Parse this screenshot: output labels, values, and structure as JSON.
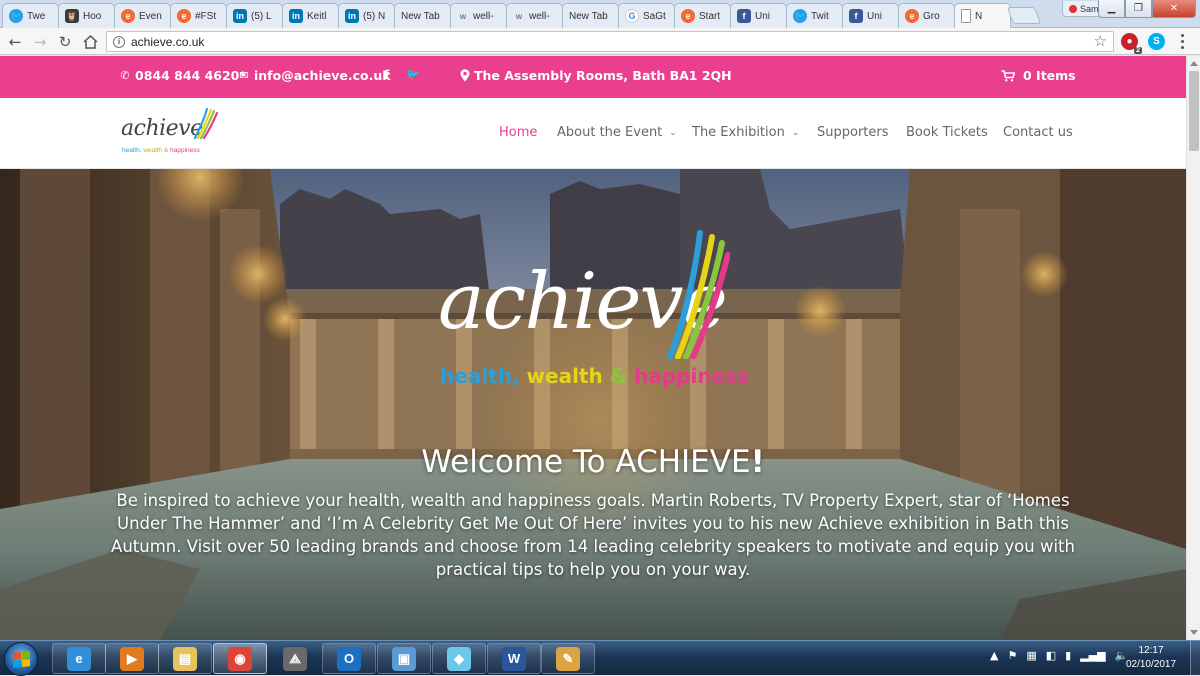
{
  "browser": {
    "tabs": [
      {
        "label": "Twe",
        "icon": "twitter-icon",
        "fav": "twitter",
        "glyph": "🐦"
      },
      {
        "label": "Hoo",
        "icon": "hootsuite-icon",
        "fav": "hoot",
        "glyph": "🦉"
      },
      {
        "label": "Even",
        "icon": "eventbrite-icon",
        "fav": "eventbrite",
        "glyph": "e"
      },
      {
        "label": "#FSt",
        "icon": "eventbrite-icon",
        "fav": "eventbrite",
        "glyph": "e"
      },
      {
        "label": "(5) L",
        "icon": "linkedin-icon",
        "fav": "linkedin",
        "glyph": "in"
      },
      {
        "label": "Keitl",
        "icon": "linkedin-icon",
        "fav": "linkedin",
        "glyph": "in"
      },
      {
        "label": "(5) N",
        "icon": "linkedin-icon",
        "fav": "linkedin",
        "glyph": "in"
      },
      {
        "label": "New Tab",
        "icon": "blank-tab-icon",
        "fav": "none",
        "glyph": ""
      },
      {
        "label": "well-",
        "icon": "wt-icon",
        "fav": "wt",
        "glyph": "w"
      },
      {
        "label": "well-",
        "icon": "wt-icon",
        "fav": "wt",
        "glyph": "w"
      },
      {
        "label": "New Tab",
        "icon": "blank-tab-icon",
        "fav": "none",
        "glyph": ""
      },
      {
        "label": "SaGt",
        "icon": "google-icon",
        "fav": "google",
        "glyph": "G"
      },
      {
        "label": "Start",
        "icon": "eventbrite-icon",
        "fav": "eventbrite",
        "glyph": "e"
      },
      {
        "label": "Uni",
        "icon": "facebook-icon",
        "fav": "facebook",
        "glyph": "f"
      },
      {
        "label": "Twit",
        "icon": "twitter-icon",
        "fav": "twitter",
        "glyph": "🐦"
      },
      {
        "label": "Uni",
        "icon": "facebook-icon",
        "fav": "facebook",
        "glyph": "f"
      },
      {
        "label": "Gro",
        "icon": "eventbrite-icon",
        "fav": "eventbrite",
        "glyph": "e"
      },
      {
        "label": "N",
        "icon": "page-icon",
        "fav": "page",
        "glyph": "",
        "active": true
      }
    ],
    "user_label": "Sam",
    "url": "achieve.co.uk",
    "lastpass_badge": "2"
  },
  "site": {
    "topbar": {
      "phone": "0844 844 4620*",
      "email": "info@achieve.co.uk",
      "facebook_glyph": "f",
      "twitter_glyph": "🐦",
      "address": "The Assembly Rooms, Bath BA1 2QH",
      "cart": "0 Items"
    },
    "logo": {
      "word": "achieve",
      "tag_health": "health,",
      "tag_wealth": "wealth",
      "tag_amp": "&",
      "tag_happiness": "happiness"
    },
    "nav": [
      {
        "label": "Home",
        "active": true,
        "dropdown": false
      },
      {
        "label": "About the Event",
        "active": false,
        "dropdown": true
      },
      {
        "label": "The Exhibition",
        "active": false,
        "dropdown": true
      },
      {
        "label": "Supporters",
        "active": false,
        "dropdown": false
      },
      {
        "label": "Book Tickets",
        "active": false,
        "dropdown": false
      },
      {
        "label": "Contact us",
        "active": false,
        "dropdown": false
      }
    ],
    "hero": {
      "title_start": "Welcome To ACHIEVE",
      "title_end": "!",
      "body": "Be inspired to achieve your health, wealth and happiness goals. Martin Roberts, TV Property Expert, star of ‘Homes Under The Hammer’ and ‘I’m A Celebrity Get Me Out Of Here’ invites you to his new Achieve exhibition in Bath this Autumn. Visit over 50 leading brands and choose from 14 leading celebrity speakers to motivate and equip you with practical tips to help you on your way."
    }
  },
  "taskbar": {
    "apps": [
      {
        "name": "internet-explorer-icon",
        "glyph": "e",
        "color": "#2f8fd8",
        "state": "pinned"
      },
      {
        "name": "media-player-icon",
        "glyph": "▶",
        "color": "#e07b1f",
        "state": "pinned"
      },
      {
        "name": "file-explorer-icon",
        "glyph": "▤",
        "color": "#e8c25a",
        "state": "pinned"
      },
      {
        "name": "chrome-icon",
        "glyph": "◉",
        "color": "#db4437",
        "state": "running"
      },
      {
        "name": "app-icon",
        "glyph": "⟁",
        "color": "#6a6a6a",
        "state": "plain"
      },
      {
        "name": "outlook-icon",
        "glyph": "O",
        "color": "#1c6fc2",
        "state": "pinned"
      },
      {
        "name": "remote-desktop-icon",
        "glyph": "▣",
        "color": "#5b9bd5",
        "state": "pinned"
      },
      {
        "name": "notes-icon",
        "glyph": "◆",
        "color": "#6ec6e8",
        "state": "pinned"
      },
      {
        "name": "word-icon",
        "glyph": "W",
        "color": "#2b579a",
        "state": "pinned"
      },
      {
        "name": "paint-icon",
        "glyph": "✎",
        "color": "#d9a441",
        "state": "pinned"
      }
    ],
    "time": "12:17",
    "date": "02/10/2017"
  },
  "colors": {
    "brand_pink": "#ea3e8e",
    "logo_blue": "#2b9fd9",
    "logo_yellow": "#e6d417",
    "logo_pink": "#e5398a",
    "logo_green": "#8bc53f"
  }
}
